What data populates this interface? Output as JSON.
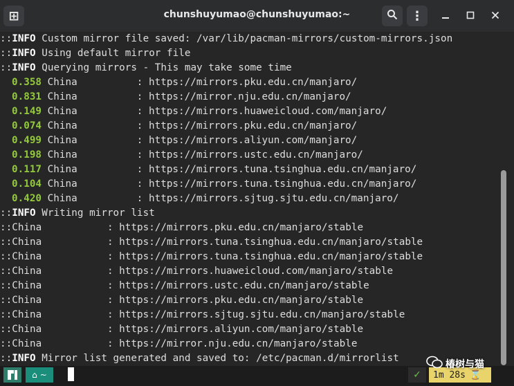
{
  "window": {
    "title": "chunshuyumao@chunshuyumao:~",
    "new_tab_glyph": "⊞",
    "search_glyph": "⌕",
    "menu_glyph": "⋮",
    "minimize_glyph": "⎯",
    "maximize_glyph": "☐",
    "close_glyph": "✕"
  },
  "terminal": {
    "prefix": "::",
    "info_tag": "INFO",
    "china": "China",
    "colon": ":",
    "info_lines": [
      "Custom mirror file saved: /var/lib/pacman-mirrors/custom-mirrors.json",
      "Using default mirror file",
      "Querying mirrors - This may take some time"
    ],
    "timings": [
      {
        "time": "0.358",
        "url": "https://mirrors.pku.edu.cn/manjaro/"
      },
      {
        "time": "0.831",
        "url": "https://mirror.nju.edu.cn/manjaro/"
      },
      {
        "time": "0.149",
        "url": "https://mirrors.huaweicloud.com/manjaro/"
      },
      {
        "time": "0.074",
        "url": "https://mirrors.pku.edu.cn/manjaro/"
      },
      {
        "time": "0.499",
        "url": "https://mirrors.aliyun.com/manjaro/"
      },
      {
        "time": "0.198",
        "url": "https://mirrors.ustc.edu.cn/manjaro/"
      },
      {
        "time": "0.117",
        "url": "https://mirrors.tuna.tsinghua.edu.cn/manjaro/"
      },
      {
        "time": "0.104",
        "url": "https://mirrors.tuna.tsinghua.edu.cn/manjaro/"
      },
      {
        "time": "0.420",
        "url": "https://mirrors.sjtug.sjtu.edu.cn/manjaro/"
      }
    ],
    "writing_line": "Writing mirror list",
    "mirrorlist": [
      "https://mirrors.pku.edu.cn/manjaro/stable",
      "https://mirrors.tuna.tsinghua.edu.cn/manjaro/stable",
      "https://mirrors.tuna.tsinghua.edu.cn/manjaro/stable",
      "https://mirrors.huaweicloud.com/manjaro/stable",
      "https://mirrors.ustc.edu.cn/manjaro/stable",
      "https://mirrors.pku.edu.cn/manjaro/stable",
      "https://mirrors.sjtug.sjtu.edu.cn/manjaro/stable",
      "https://mirrors.aliyun.com/manjaro/stable",
      "https://mirror.nju.edu.cn/manjaro/stable"
    ],
    "final_line": "Mirror list generated and saved to: /etc/pacman.d/mirrorlist"
  },
  "prompt": {
    "dir_label": "~",
    "home_glyph": "⌂",
    "status_check": "✓",
    "elapsed": "1m 28s",
    "hourglass_glyph": "⌛"
  },
  "watermark": {
    "text": "椿树与猫"
  },
  "colors": {
    "accent_green": "#93c93c",
    "prompt_teal": "#1a8d7b",
    "elapsed_yellow": "#e9d36b"
  }
}
